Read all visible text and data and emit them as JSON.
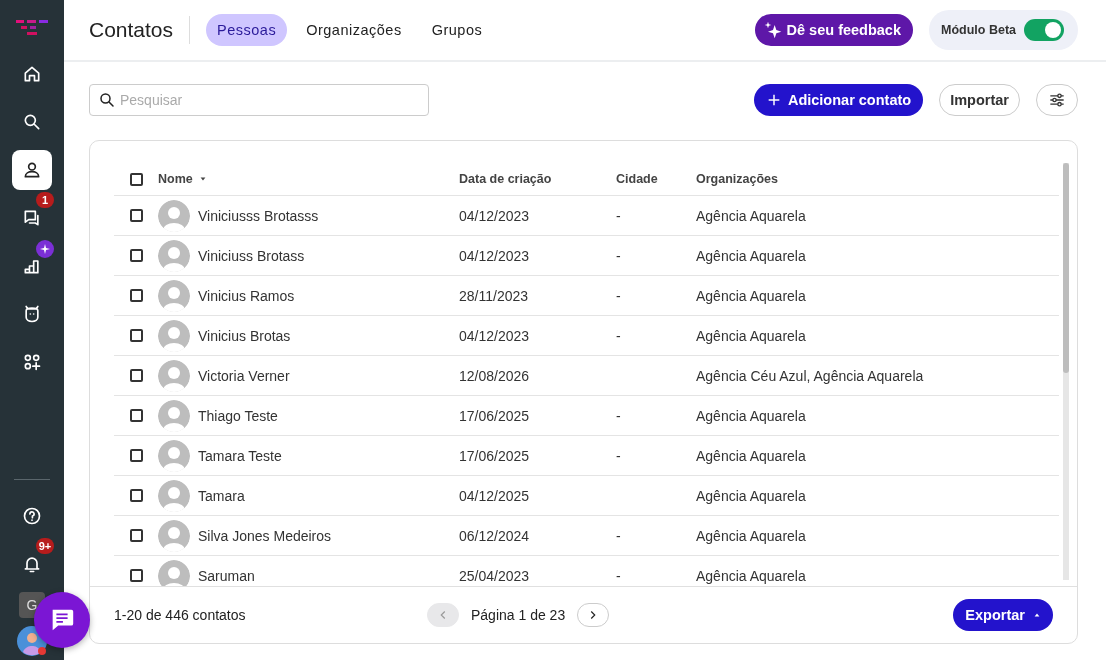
{
  "sidebar": {
    "items": [
      {
        "selected": false
      },
      {
        "selected": false
      },
      {
        "selected": true
      },
      {
        "selected": false,
        "badge": {
          "kind": "count",
          "text": "1"
        }
      },
      {
        "selected": false,
        "badge": {
          "kind": "sparkle"
        }
      },
      {
        "selected": false
      },
      {
        "selected": false
      }
    ],
    "bottom_items": [
      {
        "selected": false
      },
      {
        "selected": false,
        "badge": {
          "kind": "count",
          "text": "9+"
        }
      }
    ],
    "workspace_avatar": "G"
  },
  "header": {
    "title": "Contatos",
    "tabs": [
      {
        "label": "Pessoas",
        "selected": true
      },
      {
        "label": "Organizações",
        "selected": false
      },
      {
        "label": "Grupos",
        "selected": false
      }
    ],
    "feedback_button": "Dê seu feedback",
    "beta": {
      "label": "Módulo Beta",
      "on": true
    }
  },
  "toolbar": {
    "search": {
      "placeholder": "Pesquisar"
    },
    "add_button": "Adicionar contato",
    "import_button": "Importar"
  },
  "table": {
    "all_checked": false,
    "columns": [
      "Nome",
      "Data de criação",
      "Cidade",
      "Organizações"
    ],
    "rows": [
      {
        "checked": false,
        "name": "Viniciusss Brotasss",
        "created": "04/12/2023",
        "city": "-",
        "organizations": "Agência Aquarela"
      },
      {
        "checked": false,
        "name": "Viniciuss Brotass",
        "created": "04/12/2023",
        "city": "-",
        "organizations": "Agência Aquarela"
      },
      {
        "checked": false,
        "name": "Vinicius Ramos",
        "created": "28/11/2023",
        "city": "-",
        "organizations": "Agência Aquarela"
      },
      {
        "checked": false,
        "name": "Vinicius Brotas",
        "created": "04/12/2023",
        "city": "-",
        "organizations": "Agência Aquarela"
      },
      {
        "checked": false,
        "name": "Victoria Verner",
        "created": "12/08/2026",
        "city": "",
        "organizations": "Agência Céu Azul, Agência Aquarela"
      },
      {
        "checked": false,
        "name": "Thiago Teste",
        "created": "17/06/2025",
        "city": "-",
        "organizations": "Agência Aquarela"
      },
      {
        "checked": false,
        "name": "Tamara Teste",
        "created": "17/06/2025",
        "city": "-",
        "organizations": "Agência Aquarela"
      },
      {
        "checked": false,
        "name": "Tamara",
        "created": "04/12/2025",
        "city": "",
        "organizations": "Agência Aquarela"
      },
      {
        "checked": false,
        "name": "Silva Jones Medeiros",
        "created": "06/12/2024",
        "city": "-",
        "organizations": "Agência Aquarela"
      },
      {
        "checked": false,
        "name": "Saruman",
        "created": "25/04/2023",
        "city": "-",
        "organizations": "Agência Aquarela"
      }
    ]
  },
  "footer": {
    "count": "1-20 de 446 contatos",
    "page": "Página 1 de 23",
    "prev_disabled": true,
    "next_disabled": false,
    "export_button": "Exportar"
  }
}
